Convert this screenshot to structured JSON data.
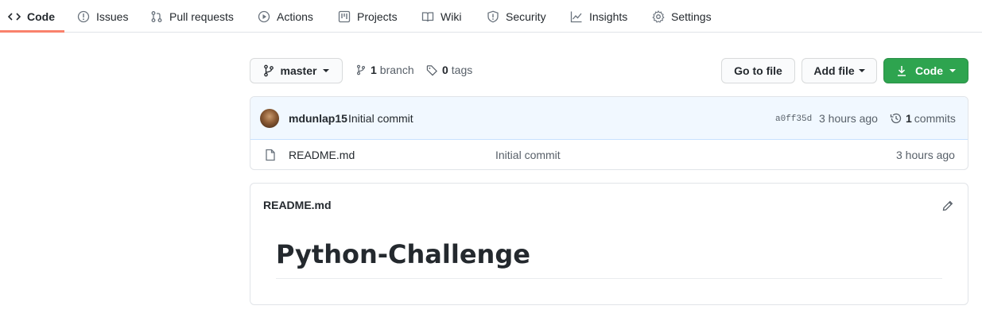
{
  "nav": {
    "tabs": [
      {
        "label": "Code",
        "icon": "code-icon",
        "active": true
      },
      {
        "label": "Issues",
        "icon": "issue-opened-icon"
      },
      {
        "label": "Pull requests",
        "icon": "git-pull-request-icon"
      },
      {
        "label": "Actions",
        "icon": "play-icon"
      },
      {
        "label": "Projects",
        "icon": "project-icon"
      },
      {
        "label": "Wiki",
        "icon": "book-icon"
      },
      {
        "label": "Security",
        "icon": "shield-icon"
      },
      {
        "label": "Insights",
        "icon": "graph-icon"
      },
      {
        "label": "Settings",
        "icon": "gear-icon"
      }
    ],
    "active_color": "#f9826c"
  },
  "repo": {
    "branch_button": "master",
    "branch_count": "1",
    "branch_label": "branch",
    "tag_count": "0",
    "tag_label": "tags",
    "go_to_file": "Go to file",
    "add_file": "Add file",
    "code_button": "Code",
    "primary_color": "#2ea44f"
  },
  "commit": {
    "author": "mdunlap15",
    "message": "Initial commit",
    "sha": "a0ff35d",
    "time": "3 hours ago",
    "commits_count": "1",
    "commits_label": "commits"
  },
  "files": [
    {
      "name": "README.md",
      "message": "Initial commit",
      "time": "3 hours ago",
      "icon": "file-icon"
    }
  ],
  "readme": {
    "filename": "README.md",
    "heading": "Python-Challenge"
  }
}
